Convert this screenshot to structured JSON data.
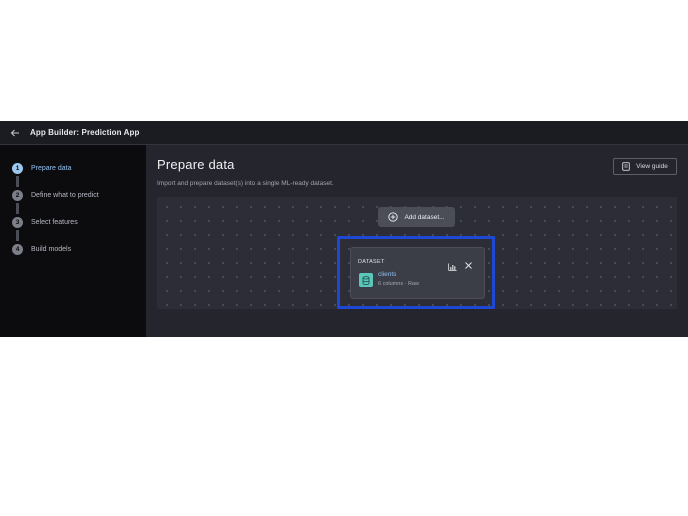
{
  "header": {
    "title": "App Builder: Prediction App"
  },
  "sidebar": {
    "steps": [
      {
        "num": "1",
        "label": "Prepare data"
      },
      {
        "num": "2",
        "label": "Define what to predict"
      },
      {
        "num": "3",
        "label": "Select features"
      },
      {
        "num": "4",
        "label": "Build models"
      }
    ]
  },
  "main": {
    "title": "Prepare data",
    "subtitle": "Import and prepare dataset(s) into a single ML-ready dataset.",
    "view_guide_label": "View guide",
    "add_dataset_label": "Add dataset...",
    "dataset_card": {
      "header": "DATASET",
      "name": "clients",
      "meta": "6 columns · Raw"
    }
  },
  "colors": {
    "accent": "#8fc0ee",
    "highlight": "#1e48d4",
    "dataset_icon": "#5bc7ba"
  },
  "icons": {
    "back": "arrow-left-icon",
    "guide": "book-icon",
    "add": "plus-circle-icon",
    "chart": "bar-chart-icon",
    "close": "close-icon",
    "dataset": "database-icon"
  }
}
